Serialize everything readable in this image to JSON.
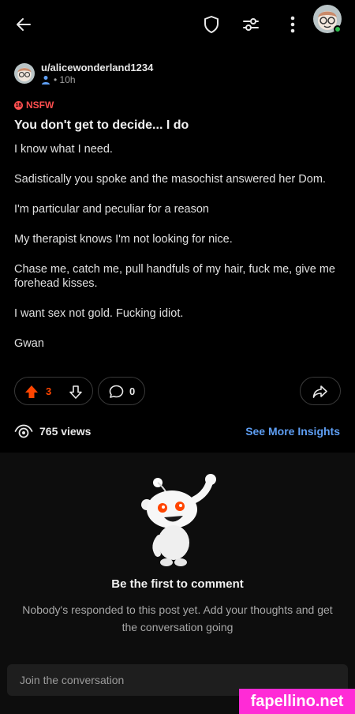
{
  "post": {
    "username": "u/alicewonderland1234",
    "time": "• 10h",
    "nsfw_label": "NSFW",
    "title": "You don't get to decide... I do",
    "paragraphs": [
      "I know what I need.",
      "Sadistically you spoke and the masochist answered her Dom.",
      "I'm particular and peculiar for a reason",
      "My therapist knows I'm not looking for nice.",
      "Chase me, catch me, pull handfuls of my hair, fuck me, give me forehead kisses.",
      "I want sex not gold. Fucking idiot.",
      "Gwan"
    ]
  },
  "actions": {
    "upvotes": "3",
    "comments": "0"
  },
  "stats": {
    "views": "765 views",
    "insights_link": "See More Insights"
  },
  "empty_state": {
    "title": "Be the first to comment",
    "subtitle": "Nobody's responded to this post yet. Add your thoughts and get the conversation going"
  },
  "composer": {
    "placeholder": "Join the conversation"
  },
  "watermark": "fapellino.net",
  "colors": {
    "upvote": "#ff4500",
    "nsfw": "#ff4f4f",
    "link": "#5e9ef3",
    "online": "#2ebd4e"
  },
  "icons": {
    "back": "arrow-left-icon",
    "mod": "shield-icon",
    "filter": "sliders-icon",
    "more": "more-vertical-icon",
    "share": "share-icon",
    "views": "eye-icon"
  }
}
